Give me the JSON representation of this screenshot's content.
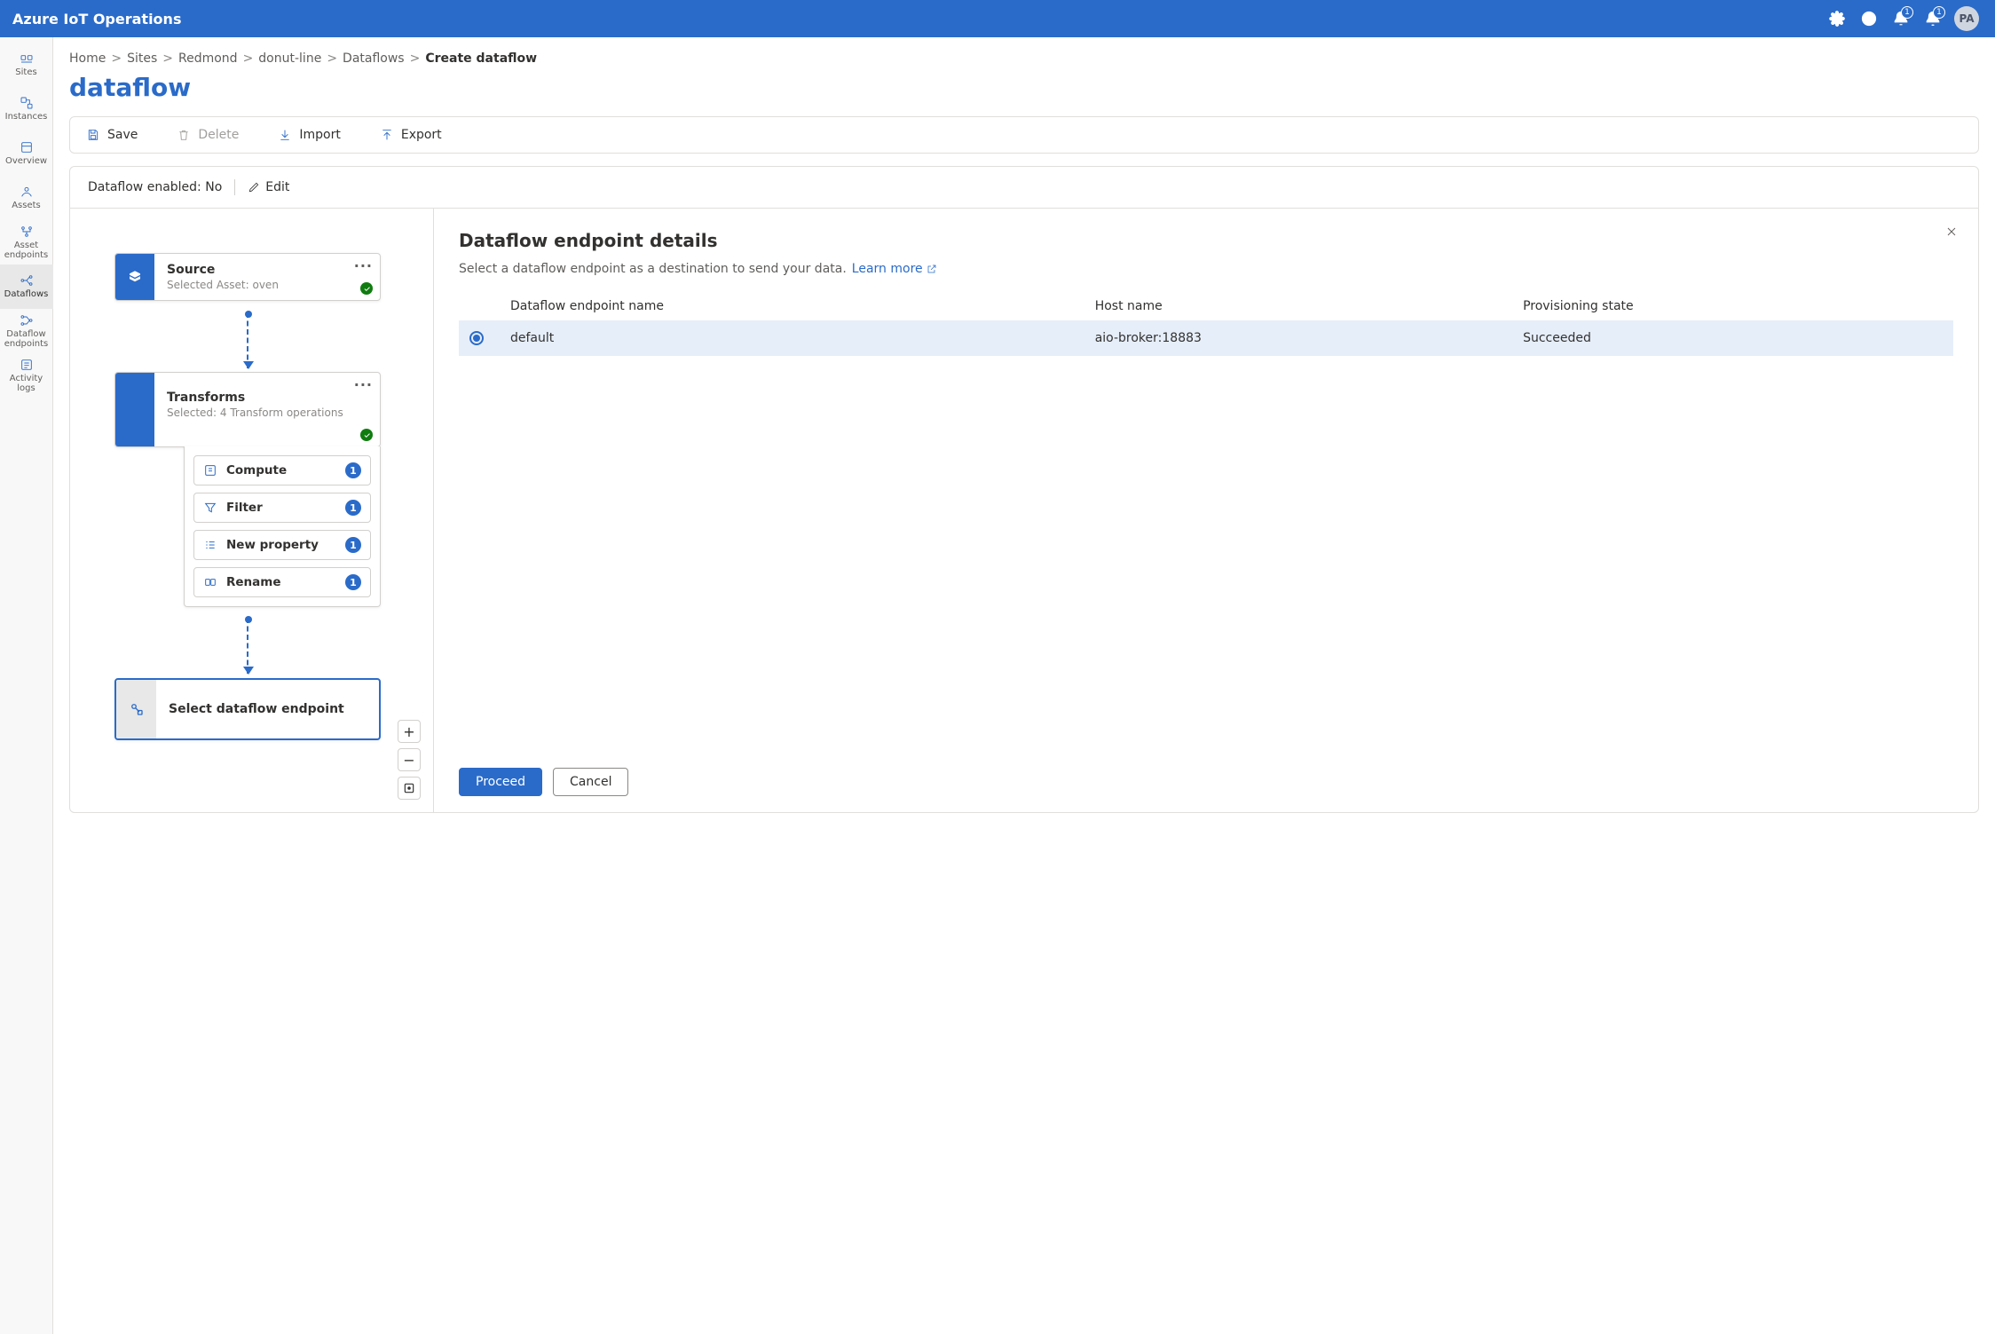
{
  "app_title": "Azure IoT Operations",
  "header": {
    "notifications_badge": "1",
    "alerts_badge": "1",
    "avatar_initials": "PA"
  },
  "sidebar": {
    "items": [
      {
        "label": "Sites"
      },
      {
        "label": "Instances"
      },
      {
        "label": "Overview"
      },
      {
        "label": "Assets"
      },
      {
        "label": "Asset endpoints"
      },
      {
        "label": "Dataflows"
      },
      {
        "label": "Dataflow endpoints"
      },
      {
        "label": "Activity logs"
      }
    ],
    "active_index": 5
  },
  "breadcrumbs": [
    {
      "text": "Home"
    },
    {
      "text": "Sites"
    },
    {
      "text": "Redmond"
    },
    {
      "text": "donut-line"
    },
    {
      "text": "Dataflows"
    },
    {
      "text": "Create dataflow",
      "current": true
    }
  ],
  "page_title": "dataflow",
  "toolbar": {
    "save_label": "Save",
    "delete_label": "Delete",
    "import_label": "Import",
    "export_label": "Export"
  },
  "status": {
    "dataflow_enabled_label": "Dataflow enabled: No",
    "edit_label": "Edit"
  },
  "canvas": {
    "source": {
      "title": "Source",
      "subtitle": "Selected Asset: oven"
    },
    "transforms": {
      "title": "Transforms",
      "subtitle": "Selected: 4 Transform operations"
    },
    "transform_ops": [
      {
        "label": "Compute",
        "count": "1"
      },
      {
        "label": "Filter",
        "count": "1"
      },
      {
        "label": "New property",
        "count": "1"
      },
      {
        "label": "Rename",
        "count": "1"
      }
    ],
    "endpoint": {
      "title": "Select dataflow endpoint"
    }
  },
  "details": {
    "title": "Dataflow endpoint details",
    "desc": "Select a dataflow endpoint as a destination to send your data.",
    "learn_more": "Learn more",
    "columns": {
      "name": "Dataflow endpoint name",
      "host": "Host name",
      "state": "Provisioning state"
    },
    "rows": [
      {
        "name": "default",
        "host": "aio-broker:18883",
        "state": "Succeeded",
        "selected": true
      }
    ],
    "proceed_label": "Proceed",
    "cancel_label": "Cancel"
  }
}
